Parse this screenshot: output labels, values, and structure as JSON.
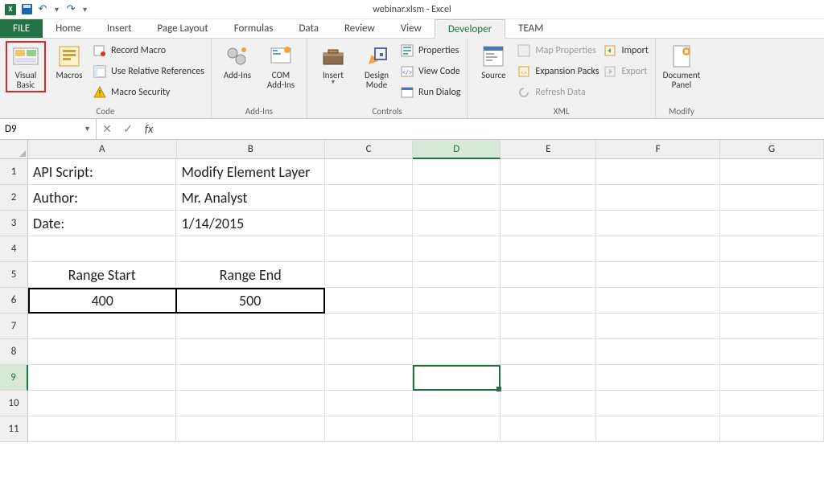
{
  "app": {
    "title": "webinar.xlsm - Excel"
  },
  "tabs": {
    "file": "FILE",
    "home": "Home",
    "insert": "Insert",
    "pageLayout": "Page Layout",
    "formulas": "Formulas",
    "data": "Data",
    "review": "Review",
    "view": "View",
    "developer": "Developer",
    "team": "TEAM"
  },
  "ribbon": {
    "code": {
      "visualBasic": "Visual Basic",
      "macros": "Macros",
      "recordMacro": "Record Macro",
      "useRel": "Use Relative References",
      "macroSec": "Macro Security",
      "label": "Code"
    },
    "addins": {
      "addins": "Add-Ins",
      "com": "COM Add-Ins",
      "label": "Add-Ins"
    },
    "controls": {
      "insert": "Insert",
      "design": "Design Mode",
      "props": "Properties",
      "viewCode": "View Code",
      "runDialog": "Run Dialog",
      "label": "Controls"
    },
    "xml": {
      "source": "Source",
      "mapProps": "Map Properties",
      "expPacks": "Expansion Packs",
      "refresh": "Refresh Data",
      "import": "Import",
      "export": "Export",
      "label": "XML"
    },
    "modify": {
      "docPanel": "Document Panel",
      "label": "Modify"
    }
  },
  "formulaBar": {
    "nameBox": "D9",
    "fx": "fx",
    "value": ""
  },
  "columns": [
    "A",
    "B",
    "C",
    "D",
    "E",
    "F",
    "G"
  ],
  "selCol": "D",
  "rows": [
    "1",
    "2",
    "3",
    "4",
    "5",
    "6",
    "7",
    "8",
    "9",
    "10",
    "11"
  ],
  "selRow": "9",
  "sheet": {
    "A1": "API Script:",
    "B1": "Modify Element Layer",
    "A2": "Author:",
    "B2": "Mr. Analyst",
    "A3": "Date:",
    "B3": "1/14/2015",
    "A5": "Range Start",
    "B5": "Range End",
    "A6": "400",
    "B6": "500"
  }
}
